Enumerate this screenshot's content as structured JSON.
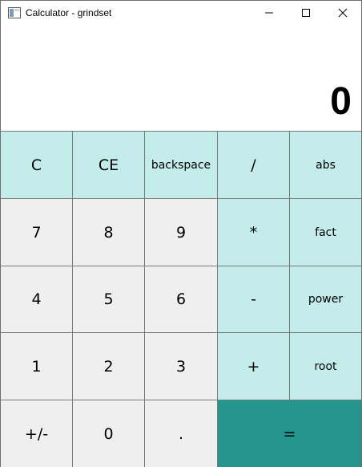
{
  "window": {
    "title": "Calculator - grindset",
    "icons": {
      "app": "window-app-icon",
      "minimize": "minimize-icon",
      "maximize": "maximize-icon",
      "close": "close-icon"
    }
  },
  "display": {
    "value": "0"
  },
  "keypad": {
    "rows": [
      [
        "C",
        "CE",
        "backspace",
        "/",
        "abs"
      ],
      [
        "7",
        "8",
        "9",
        "*",
        "fact"
      ],
      [
        "4",
        "5",
        "6",
        "-",
        "power"
      ],
      [
        "1",
        "2",
        "3",
        "+",
        "root"
      ],
      [
        "+/-",
        "0",
        ".",
        "="
      ]
    ]
  },
  "colors": {
    "operator_bg": "#c3ecea",
    "number_bg": "#efefef",
    "equals_bg": "#23958d",
    "grid_lines": "#7a7a7a"
  }
}
